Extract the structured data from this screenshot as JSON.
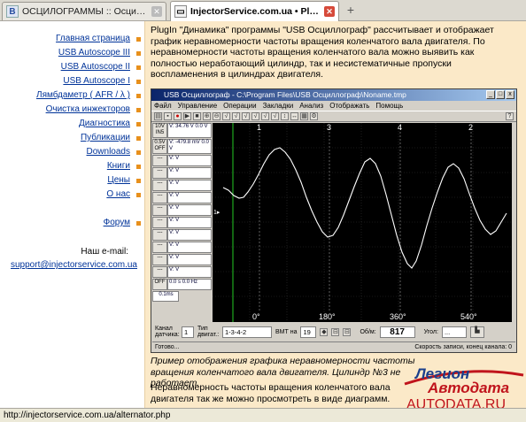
{
  "tabs": [
    {
      "label": "ОСЦИЛОГРАММЫ :: Осциллограммы:",
      "icon": "B"
    },
    {
      "label": "InjectorService.com.ua • PlugIn ...",
      "icon": "▭"
    }
  ],
  "new_tab_label": "+",
  "nav": [
    "Главная страница",
    "USB Autoscope III",
    "USB Autoscope II",
    "USB Autoscope I",
    "Лямбдаметр ( AFR / λ )",
    "Очистка инжекторов",
    "Диагностика",
    "Публикации",
    "Downloads",
    "Книги",
    "Цены",
    "О нас",
    "Форум"
  ],
  "email_label": "Наш e-mail:",
  "email": "support@injectorservice.com.ua",
  "intro": "PlugIn \"Динамика\" программы \"USB Осциллограф\" рассчитывает и отображает график неравномерности частоты вращения коленчатого вала двигателя. По неравномерности частоты вращения коленчатого вала можно выявить как полностью неработающий цилиндр, так и несистематичные пропуски воспламенения в цилиндрах двигателя.",
  "osc": {
    "title": "USB Осциллограф - C:\\Program Files\\USB Осциллограф\\Noname.tmp",
    "menu": [
      "Файл",
      "Управление",
      "Операции",
      "Закладки",
      "Анализ",
      "Отображать",
      "Помощь"
    ],
    "channels": [
      {
        "btn": "10V IN5",
        "val": "V: 34.76 V  0.0 V"
      },
      {
        "btn": "0.5V OFF",
        "val": "V: -479.8 mV  0.0 V"
      },
      {
        "btn": "---",
        "val": "V:  V"
      },
      {
        "btn": "---",
        "val": "V:  V"
      },
      {
        "btn": "---",
        "val": "V:  V"
      },
      {
        "btn": "---",
        "val": "V:  V"
      },
      {
        "btn": "---",
        "val": "V:  V"
      },
      {
        "btn": "---",
        "val": "V:  V"
      },
      {
        "btn": "---",
        "val": "V:  V"
      },
      {
        "btn": "---",
        "val": "V:  V"
      },
      {
        "btn": "---",
        "val": "V:  V"
      },
      {
        "btn": "---",
        "val": "V:  V"
      }
    ],
    "side_bottom": [
      "OFF",
      "0.0 s",
      "0.0 Hz"
    ],
    "timebase": "0.1ms",
    "marker_labels": [
      "1",
      "3",
      "4",
      "2"
    ],
    "degree_labels": [
      "0°",
      "180°",
      "360°",
      "540°"
    ],
    "ch_marker": "1▸",
    "bottom": {
      "channel_label": "Канал датчика:",
      "channel_value": "1",
      "type_label": "Тип двигат.:",
      "order_value": "1-3-4-2",
      "vmt_label": "ВМТ на",
      "vmt_value": "19",
      "rpm_label": "Об/м:",
      "rpm_value": "817",
      "angle_label": "Угол:",
      "angle_value": "..."
    },
    "status_left": "Готово...",
    "status_right": "Скорость записи, конец канала: 0"
  },
  "caption": "Пример отображения графика неравномерности частоты вращения коленчатого вала двигателя. Цилиндр №3 не работает.",
  "para2": "Неравномерность частоты вращения коленчатого вала двигателя так же можно просмотреть в виде диаграмм.",
  "logo": {
    "line1": "Легион",
    "line2": "Автодата",
    "line3": "AUTODATA.RU"
  },
  "statusbar": "http://injectorservice.com.ua/alternator.php",
  "colors": {
    "link": "#003399",
    "panel": "#fbe9c8",
    "bullet": "#e8901c",
    "trace": "#ffffff",
    "grid_marker": "#1fa81f"
  }
}
